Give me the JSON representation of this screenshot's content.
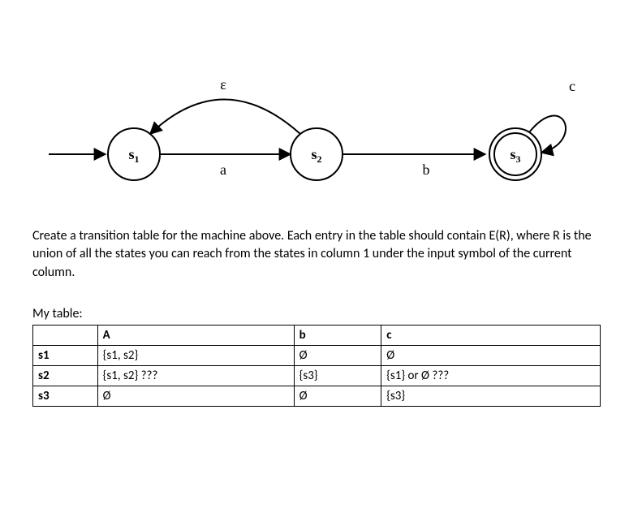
{
  "diagram": {
    "states": {
      "s1": "s",
      "s1_sub": "1",
      "s2": "s",
      "s2_sub": "2",
      "s3": "s",
      "s3_sub": "3"
    },
    "edges": {
      "eps": "ε",
      "a": "a",
      "b": "b",
      "c": "c"
    }
  },
  "prompt": "Create a transition table for the machine above. Each entry in the table should contain E(R), where R is the union of all the states you can reach from the states in column 1 under the input symbol of the current column.",
  "table_title": "My table:",
  "table": {
    "headers": [
      "",
      "A",
      "b",
      "c"
    ],
    "rows": [
      {
        "label": "s1",
        "cells": [
          "{s1, s2}",
          "Ø",
          "Ø"
        ]
      },
      {
        "label": "s2",
        "cells": [
          "{s1, s2} ???",
          "{s3}",
          "{s1} or Ø ???"
        ]
      },
      {
        "label": "s3",
        "cells": [
          "Ø",
          "Ø",
          "{s3}"
        ]
      }
    ]
  }
}
